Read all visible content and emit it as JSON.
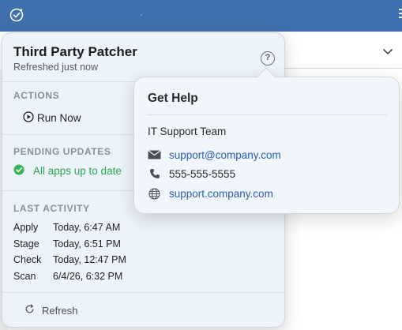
{
  "popover": {
    "title": "Third Party Patcher",
    "subtitle": "Refreshed just now",
    "help_icon": "question-circle-icon"
  },
  "actions": {
    "section_label": "ACTIONS",
    "run_now_label": "Run Now",
    "run_now_icon": "play-circle-icon"
  },
  "pending": {
    "section_label": "PENDING UPDATES",
    "status_text": "All apps up to date",
    "status_icon": "check-circle-icon",
    "status_color": "#2ea44f"
  },
  "last_activity": {
    "section_label": "LAST ACTIVITY",
    "rows": [
      {
        "label": "Apply",
        "value": "Today, 6:47 AM"
      },
      {
        "label": "Stage",
        "value": "Today, 6:51 PM"
      },
      {
        "label": "Check",
        "value": "Today, 12:47 PM"
      },
      {
        "label": "Scan",
        "value": "6/4/26, 6:32 PM"
      }
    ]
  },
  "refresh": {
    "label": "Refresh",
    "icon": "refresh-icon"
  },
  "help": {
    "title": "Get Help",
    "team": "IT Support Team",
    "email": "support@company.com",
    "phone": "555-555-5555",
    "website": "support.company.com",
    "email_icon": "envelope-icon",
    "phone_icon": "phone-icon",
    "web_icon": "globe-icon"
  },
  "colors": {
    "menubar": "#3f70ad",
    "link": "#2a5bb5"
  }
}
